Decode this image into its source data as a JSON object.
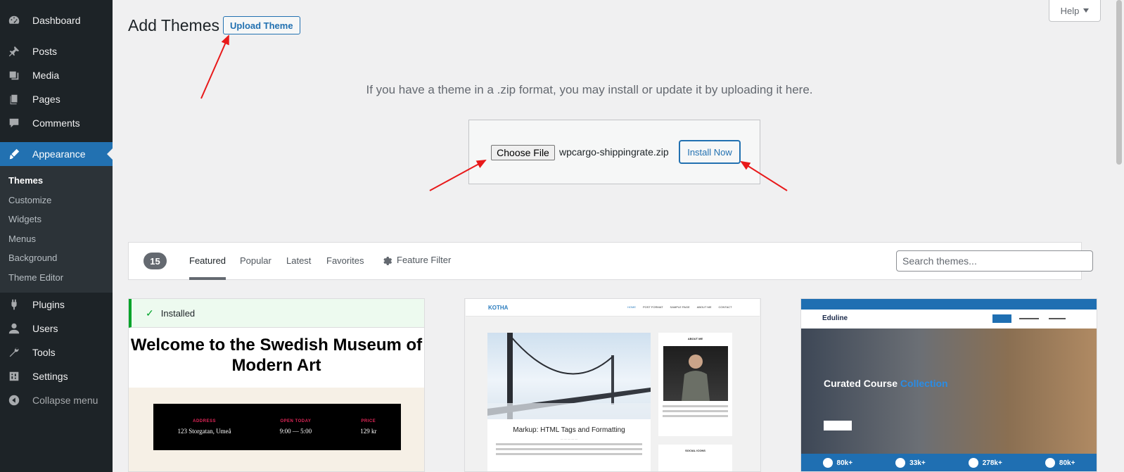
{
  "sidebar": {
    "items": [
      {
        "label": "Dashboard",
        "icon": "dashboard-icon"
      },
      {
        "label": "Posts",
        "icon": "pin-icon"
      },
      {
        "label": "Media",
        "icon": "media-icon"
      },
      {
        "label": "Pages",
        "icon": "pages-icon"
      },
      {
        "label": "Comments",
        "icon": "comment-icon"
      },
      {
        "label": "Appearance",
        "icon": "paintbrush-icon",
        "active": true
      },
      {
        "label": "Plugins",
        "icon": "plug-icon"
      },
      {
        "label": "Users",
        "icon": "user-icon"
      },
      {
        "label": "Tools",
        "icon": "wrench-icon"
      },
      {
        "label": "Settings",
        "icon": "settings-icon"
      }
    ],
    "submenu": [
      "Themes",
      "Customize",
      "Widgets",
      "Menus",
      "Background",
      "Theme Editor"
    ],
    "current_submenu": "Themes",
    "collapse_label": "Collapse menu"
  },
  "header": {
    "title": "Add Themes",
    "upload_label": "Upload Theme",
    "help_label": "Help"
  },
  "upload": {
    "description": "If you have a theme in a .zip format, you may install or update it by uploading it here.",
    "choose_file_label": "Choose File",
    "file_name": "wpcargo-shippingrate.zip",
    "install_label": "Install Now"
  },
  "filter": {
    "count": "15",
    "tabs": [
      "Featured",
      "Popular",
      "Latest",
      "Favorites"
    ],
    "current_tab": "Featured",
    "feature_filter_label": "Feature Filter",
    "search_placeholder": "Search themes..."
  },
  "themes": {
    "card1": {
      "installed_label": "Installed",
      "title": "Welcome to the Swedish Museum of Modern Art",
      "info": [
        {
          "label": "ADDRESS",
          "value": "123 Storgatan, Umeå"
        },
        {
          "label": "OPEN TODAY",
          "value": "9:00 — 5:00"
        },
        {
          "label": "PRICE",
          "value": "129 kr"
        }
      ]
    },
    "card2": {
      "logo": "KOTHA",
      "nav": [
        "HOME",
        "POST FORMAT",
        "SAMPLE PAGE",
        "ABOUT ME",
        "CONTACT"
      ],
      "post_title": "Markup: HTML Tags and Formatting",
      "about_label": "ABOUT ME",
      "social_label": "SOCIAL ICONS"
    },
    "card3": {
      "logo": "Eduline",
      "hero_title": "Curated Course",
      "hero_title_accent": "Collection",
      "stats": [
        "80k+",
        "33k+",
        "278k+",
        "80k+"
      ]
    }
  },
  "colors": {
    "sidebar_bg": "#1d2327",
    "accent": "#2271b1",
    "annotation_arrow": "#e8191a"
  }
}
